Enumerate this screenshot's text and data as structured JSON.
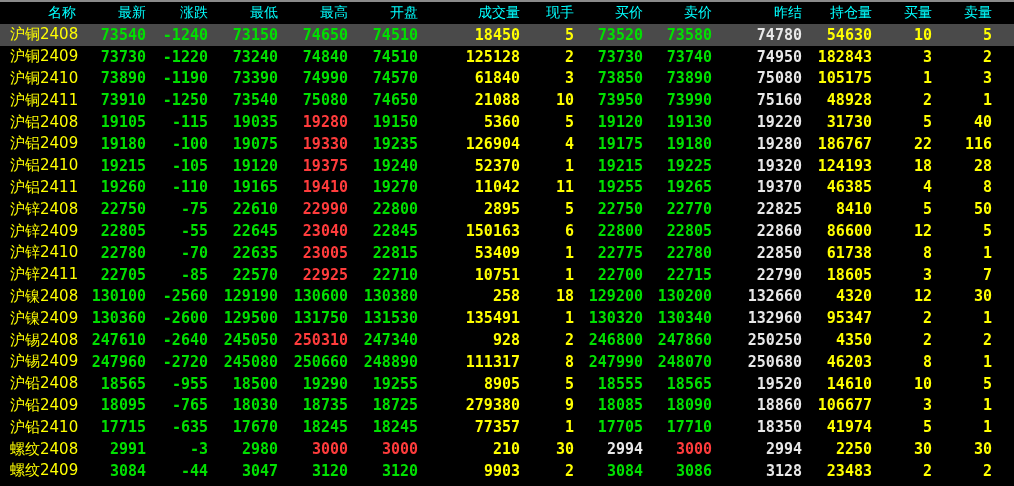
{
  "table": {
    "columns": [
      {
        "label": "名称",
        "kind": "name"
      },
      {
        "label": "最新",
        "kind": "price"
      },
      {
        "label": "涨跌",
        "kind": "price"
      },
      {
        "label": "最低",
        "kind": "price"
      },
      {
        "label": "最高",
        "kind": "price"
      },
      {
        "label": "开盘",
        "kind": "price"
      },
      {
        "label": "成交量",
        "kind": "volume"
      },
      {
        "label": "现手",
        "kind": "volume"
      },
      {
        "label": "买价",
        "kind": "price"
      },
      {
        "label": "卖价",
        "kind": "price"
      },
      {
        "label": "昨结",
        "kind": "settle"
      },
      {
        "label": "持仓量",
        "kind": "volume"
      },
      {
        "label": "买量",
        "kind": "volume"
      },
      {
        "label": "卖量",
        "kind": "volume"
      }
    ],
    "rows": [
      {
        "selected": true,
        "cells": [
          {
            "text": "沪铜2408"
          },
          {
            "text": "73540",
            "color": "#00e000"
          },
          {
            "text": "-1240",
            "color": "#00e000"
          },
          {
            "text": "73150",
            "color": "#00e000"
          },
          {
            "text": "74650",
            "color": "#00e000"
          },
          {
            "text": "74510",
            "color": "#00e000"
          },
          {
            "text": "18450"
          },
          {
            "text": "5"
          },
          {
            "text": "73520",
            "color": "#00e000"
          },
          {
            "text": "73580",
            "color": "#00e000"
          },
          {
            "text": "74780"
          },
          {
            "text": "54630"
          },
          {
            "text": "10"
          },
          {
            "text": "5"
          }
        ]
      },
      {
        "selected": false,
        "cells": [
          {
            "text": "沪铜2409"
          },
          {
            "text": "73730",
            "color": "#00e000"
          },
          {
            "text": "-1220",
            "color": "#00e000"
          },
          {
            "text": "73240",
            "color": "#00e000"
          },
          {
            "text": "74840",
            "color": "#00e000"
          },
          {
            "text": "74510",
            "color": "#00e000"
          },
          {
            "text": "125128"
          },
          {
            "text": "2"
          },
          {
            "text": "73730",
            "color": "#00e000"
          },
          {
            "text": "73740",
            "color": "#00e000"
          },
          {
            "text": "74950"
          },
          {
            "text": "182843"
          },
          {
            "text": "3"
          },
          {
            "text": "2"
          }
        ]
      },
      {
        "selected": false,
        "cells": [
          {
            "text": "沪铜2410"
          },
          {
            "text": "73890",
            "color": "#00e000"
          },
          {
            "text": "-1190",
            "color": "#00e000"
          },
          {
            "text": "73390",
            "color": "#00e000"
          },
          {
            "text": "74990",
            "color": "#00e000"
          },
          {
            "text": "74570",
            "color": "#00e000"
          },
          {
            "text": "61840"
          },
          {
            "text": "3"
          },
          {
            "text": "73850",
            "color": "#00e000"
          },
          {
            "text": "73890",
            "color": "#00e000"
          },
          {
            "text": "75080"
          },
          {
            "text": "105175"
          },
          {
            "text": "1"
          },
          {
            "text": "3"
          }
        ]
      },
      {
        "selected": false,
        "cells": [
          {
            "text": "沪铜2411"
          },
          {
            "text": "73910",
            "color": "#00e000"
          },
          {
            "text": "-1250",
            "color": "#00e000"
          },
          {
            "text": "73540",
            "color": "#00e000"
          },
          {
            "text": "75080",
            "color": "#00e000"
          },
          {
            "text": "74650",
            "color": "#00e000"
          },
          {
            "text": "21088"
          },
          {
            "text": "10"
          },
          {
            "text": "73950",
            "color": "#00e000"
          },
          {
            "text": "73990",
            "color": "#00e000"
          },
          {
            "text": "75160"
          },
          {
            "text": "48928"
          },
          {
            "text": "2"
          },
          {
            "text": "1"
          }
        ]
      },
      {
        "selected": false,
        "cells": [
          {
            "text": "沪铝2408"
          },
          {
            "text": "19105",
            "color": "#00e000"
          },
          {
            "text": "-115",
            "color": "#00e000"
          },
          {
            "text": "19035",
            "color": "#00e000"
          },
          {
            "text": "19280",
            "color": "#ff3c3c"
          },
          {
            "text": "19150",
            "color": "#00e000"
          },
          {
            "text": "5360"
          },
          {
            "text": "5"
          },
          {
            "text": "19120",
            "color": "#00e000"
          },
          {
            "text": "19130",
            "color": "#00e000"
          },
          {
            "text": "19220"
          },
          {
            "text": "31730"
          },
          {
            "text": "5"
          },
          {
            "text": "40"
          }
        ]
      },
      {
        "selected": false,
        "cells": [
          {
            "text": "沪铝2409"
          },
          {
            "text": "19180",
            "color": "#00e000"
          },
          {
            "text": "-100",
            "color": "#00e000"
          },
          {
            "text": "19075",
            "color": "#00e000"
          },
          {
            "text": "19330",
            "color": "#ff3c3c"
          },
          {
            "text": "19235",
            "color": "#00e000"
          },
          {
            "text": "126904"
          },
          {
            "text": "4"
          },
          {
            "text": "19175",
            "color": "#00e000"
          },
          {
            "text": "19180",
            "color": "#00e000"
          },
          {
            "text": "19280"
          },
          {
            "text": "186767"
          },
          {
            "text": "22"
          },
          {
            "text": "116"
          }
        ]
      },
      {
        "selected": false,
        "cells": [
          {
            "text": "沪铝2410"
          },
          {
            "text": "19215",
            "color": "#00e000"
          },
          {
            "text": "-105",
            "color": "#00e000"
          },
          {
            "text": "19120",
            "color": "#00e000"
          },
          {
            "text": "19375",
            "color": "#ff3c3c"
          },
          {
            "text": "19240",
            "color": "#00e000"
          },
          {
            "text": "52370"
          },
          {
            "text": "1"
          },
          {
            "text": "19215",
            "color": "#00e000"
          },
          {
            "text": "19225",
            "color": "#00e000"
          },
          {
            "text": "19320"
          },
          {
            "text": "124193"
          },
          {
            "text": "18"
          },
          {
            "text": "28"
          }
        ]
      },
      {
        "selected": false,
        "cells": [
          {
            "text": "沪铝2411"
          },
          {
            "text": "19260",
            "color": "#00e000"
          },
          {
            "text": "-110",
            "color": "#00e000"
          },
          {
            "text": "19165",
            "color": "#00e000"
          },
          {
            "text": "19410",
            "color": "#ff3c3c"
          },
          {
            "text": "19270",
            "color": "#00e000"
          },
          {
            "text": "11042"
          },
          {
            "text": "11"
          },
          {
            "text": "19255",
            "color": "#00e000"
          },
          {
            "text": "19265",
            "color": "#00e000"
          },
          {
            "text": "19370"
          },
          {
            "text": "46385"
          },
          {
            "text": "4"
          },
          {
            "text": "8"
          }
        ]
      },
      {
        "selected": false,
        "cells": [
          {
            "text": "沪锌2408"
          },
          {
            "text": "22750",
            "color": "#00e000"
          },
          {
            "text": "-75",
            "color": "#00e000"
          },
          {
            "text": "22610",
            "color": "#00e000"
          },
          {
            "text": "22990",
            "color": "#ff3c3c"
          },
          {
            "text": "22800",
            "color": "#00e000"
          },
          {
            "text": "2895"
          },
          {
            "text": "5"
          },
          {
            "text": "22750",
            "color": "#00e000"
          },
          {
            "text": "22770",
            "color": "#00e000"
          },
          {
            "text": "22825"
          },
          {
            "text": "8410"
          },
          {
            "text": "5"
          },
          {
            "text": "50"
          }
        ]
      },
      {
        "selected": false,
        "cells": [
          {
            "text": "沪锌2409"
          },
          {
            "text": "22805",
            "color": "#00e000"
          },
          {
            "text": "-55",
            "color": "#00e000"
          },
          {
            "text": "22645",
            "color": "#00e000"
          },
          {
            "text": "23040",
            "color": "#ff3c3c"
          },
          {
            "text": "22845",
            "color": "#00e000"
          },
          {
            "text": "150163"
          },
          {
            "text": "6"
          },
          {
            "text": "22800",
            "color": "#00e000"
          },
          {
            "text": "22805",
            "color": "#00e000"
          },
          {
            "text": "22860"
          },
          {
            "text": "86600"
          },
          {
            "text": "12"
          },
          {
            "text": "5"
          }
        ]
      },
      {
        "selected": false,
        "cells": [
          {
            "text": "沪锌2410"
          },
          {
            "text": "22780",
            "color": "#00e000"
          },
          {
            "text": "-70",
            "color": "#00e000"
          },
          {
            "text": "22635",
            "color": "#00e000"
          },
          {
            "text": "23005",
            "color": "#ff3c3c"
          },
          {
            "text": "22815",
            "color": "#00e000"
          },
          {
            "text": "53409"
          },
          {
            "text": "1"
          },
          {
            "text": "22775",
            "color": "#00e000"
          },
          {
            "text": "22780",
            "color": "#00e000"
          },
          {
            "text": "22850"
          },
          {
            "text": "61738"
          },
          {
            "text": "8"
          },
          {
            "text": "1"
          }
        ]
      },
      {
        "selected": false,
        "cells": [
          {
            "text": "沪锌2411"
          },
          {
            "text": "22705",
            "color": "#00e000"
          },
          {
            "text": "-85",
            "color": "#00e000"
          },
          {
            "text": "22570",
            "color": "#00e000"
          },
          {
            "text": "22925",
            "color": "#ff3c3c"
          },
          {
            "text": "22710",
            "color": "#00e000"
          },
          {
            "text": "10751"
          },
          {
            "text": "1"
          },
          {
            "text": "22700",
            "color": "#00e000"
          },
          {
            "text": "22715",
            "color": "#00e000"
          },
          {
            "text": "22790"
          },
          {
            "text": "18605"
          },
          {
            "text": "3"
          },
          {
            "text": "7"
          }
        ]
      },
      {
        "selected": false,
        "cells": [
          {
            "text": "沪镍2408"
          },
          {
            "text": "130100",
            "color": "#00e000"
          },
          {
            "text": "-2560",
            "color": "#00e000"
          },
          {
            "text": "129190",
            "color": "#00e000"
          },
          {
            "text": "130600",
            "color": "#00e000"
          },
          {
            "text": "130380",
            "color": "#00e000"
          },
          {
            "text": "258"
          },
          {
            "text": "18"
          },
          {
            "text": "129200",
            "color": "#00e000"
          },
          {
            "text": "130200",
            "color": "#00e000"
          },
          {
            "text": "132660"
          },
          {
            "text": "4320"
          },
          {
            "text": "12"
          },
          {
            "text": "30"
          }
        ]
      },
      {
        "selected": false,
        "cells": [
          {
            "text": "沪镍2409"
          },
          {
            "text": "130360",
            "color": "#00e000"
          },
          {
            "text": "-2600",
            "color": "#00e000"
          },
          {
            "text": "129500",
            "color": "#00e000"
          },
          {
            "text": "131750",
            "color": "#00e000"
          },
          {
            "text": "131530",
            "color": "#00e000"
          },
          {
            "text": "135491"
          },
          {
            "text": "1"
          },
          {
            "text": "130320",
            "color": "#00e000"
          },
          {
            "text": "130340",
            "color": "#00e000"
          },
          {
            "text": "132960"
          },
          {
            "text": "95347"
          },
          {
            "text": "2"
          },
          {
            "text": "1"
          }
        ]
      },
      {
        "selected": false,
        "cells": [
          {
            "text": "沪锡2408"
          },
          {
            "text": "247610",
            "color": "#00e000"
          },
          {
            "text": "-2640",
            "color": "#00e000"
          },
          {
            "text": "245050",
            "color": "#00e000"
          },
          {
            "text": "250310",
            "color": "#ff3c3c"
          },
          {
            "text": "247340",
            "color": "#00e000"
          },
          {
            "text": "928"
          },
          {
            "text": "2"
          },
          {
            "text": "246800",
            "color": "#00e000"
          },
          {
            "text": "247860",
            "color": "#00e000"
          },
          {
            "text": "250250"
          },
          {
            "text": "4350"
          },
          {
            "text": "2"
          },
          {
            "text": "2"
          }
        ]
      },
      {
        "selected": false,
        "cells": [
          {
            "text": "沪锡2409"
          },
          {
            "text": "247960",
            "color": "#00e000"
          },
          {
            "text": "-2720",
            "color": "#00e000"
          },
          {
            "text": "245080",
            "color": "#00e000"
          },
          {
            "text": "250660",
            "color": "#00e000"
          },
          {
            "text": "248890",
            "color": "#00e000"
          },
          {
            "text": "111317"
          },
          {
            "text": "8"
          },
          {
            "text": "247990",
            "color": "#00e000"
          },
          {
            "text": "248070",
            "color": "#00e000"
          },
          {
            "text": "250680"
          },
          {
            "text": "46203"
          },
          {
            "text": "8"
          },
          {
            "text": "1"
          }
        ]
      },
      {
        "selected": false,
        "cells": [
          {
            "text": "沪铅2408"
          },
          {
            "text": "18565",
            "color": "#00e000"
          },
          {
            "text": "-955",
            "color": "#00e000"
          },
          {
            "text": "18500",
            "color": "#00e000"
          },
          {
            "text": "19290",
            "color": "#00e000"
          },
          {
            "text": "19255",
            "color": "#00e000"
          },
          {
            "text": "8905"
          },
          {
            "text": "5"
          },
          {
            "text": "18555",
            "color": "#00e000"
          },
          {
            "text": "18565",
            "color": "#00e000"
          },
          {
            "text": "19520"
          },
          {
            "text": "14610"
          },
          {
            "text": "10"
          },
          {
            "text": "5"
          }
        ]
      },
      {
        "selected": false,
        "cells": [
          {
            "text": "沪铅2409"
          },
          {
            "text": "18095",
            "color": "#00e000"
          },
          {
            "text": "-765",
            "color": "#00e000"
          },
          {
            "text": "18030",
            "color": "#00e000"
          },
          {
            "text": "18735",
            "color": "#00e000"
          },
          {
            "text": "18725",
            "color": "#00e000"
          },
          {
            "text": "279380"
          },
          {
            "text": "9"
          },
          {
            "text": "18085",
            "color": "#00e000"
          },
          {
            "text": "18090",
            "color": "#00e000"
          },
          {
            "text": "18860"
          },
          {
            "text": "106677"
          },
          {
            "text": "3"
          },
          {
            "text": "1"
          }
        ]
      },
      {
        "selected": false,
        "cells": [
          {
            "text": "沪铅2410"
          },
          {
            "text": "17715",
            "color": "#00e000"
          },
          {
            "text": "-635",
            "color": "#00e000"
          },
          {
            "text": "17670",
            "color": "#00e000"
          },
          {
            "text": "18245",
            "color": "#00e000"
          },
          {
            "text": "18245",
            "color": "#00e000"
          },
          {
            "text": "77357"
          },
          {
            "text": "1"
          },
          {
            "text": "17705",
            "color": "#00e000"
          },
          {
            "text": "17710",
            "color": "#00e000"
          },
          {
            "text": "18350"
          },
          {
            "text": "41974"
          },
          {
            "text": "5"
          },
          {
            "text": "1"
          }
        ]
      },
      {
        "selected": false,
        "cells": [
          {
            "text": "螺纹2408"
          },
          {
            "text": "2991",
            "color": "#00e000"
          },
          {
            "text": "-3",
            "color": "#00e000"
          },
          {
            "text": "2980",
            "color": "#00e000"
          },
          {
            "text": "3000",
            "color": "#ff3c3c"
          },
          {
            "text": "3000",
            "color": "#ff3c3c"
          },
          {
            "text": "210"
          },
          {
            "text": "30"
          },
          {
            "text": "2994",
            "color": "#e8e8e8"
          },
          {
            "text": "3000",
            "color": "#ff3c3c"
          },
          {
            "text": "2994"
          },
          {
            "text": "2250"
          },
          {
            "text": "30"
          },
          {
            "text": "30"
          }
        ]
      },
      {
        "selected": false,
        "cells": [
          {
            "text": "螺纹2409"
          },
          {
            "text": "3084",
            "color": "#00e000"
          },
          {
            "text": "-44",
            "color": "#00e000"
          },
          {
            "text": "3047",
            "color": "#00e000"
          },
          {
            "text": "3120",
            "color": "#00e000"
          },
          {
            "text": "3120",
            "color": "#00e000"
          },
          {
            "text": "9903"
          },
          {
            "text": "2"
          },
          {
            "text": "3084",
            "color": "#00e000"
          },
          {
            "text": "3086",
            "color": "#00e000"
          },
          {
            "text": "3128"
          },
          {
            "text": "23483"
          },
          {
            "text": "2"
          },
          {
            "text": "2"
          }
        ]
      }
    ]
  }
}
